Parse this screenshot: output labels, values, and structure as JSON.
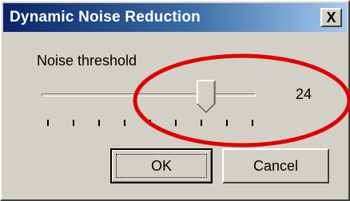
{
  "window": {
    "title": "Dynamic Noise Reduction",
    "close_glyph": "X"
  },
  "slider": {
    "label": "Noise threshold",
    "value_text": "24",
    "position_fraction": 0.77
  },
  "buttons": {
    "ok_label": "OK",
    "cancel_label": "Cancel"
  },
  "colors": {
    "titlebar_start": "#0a246a",
    "titlebar_end": "#a6caf0",
    "dialog_face": "#d4d0c8",
    "annotation_circle": "#e00000"
  },
  "icons": {
    "close": "close-icon"
  }
}
